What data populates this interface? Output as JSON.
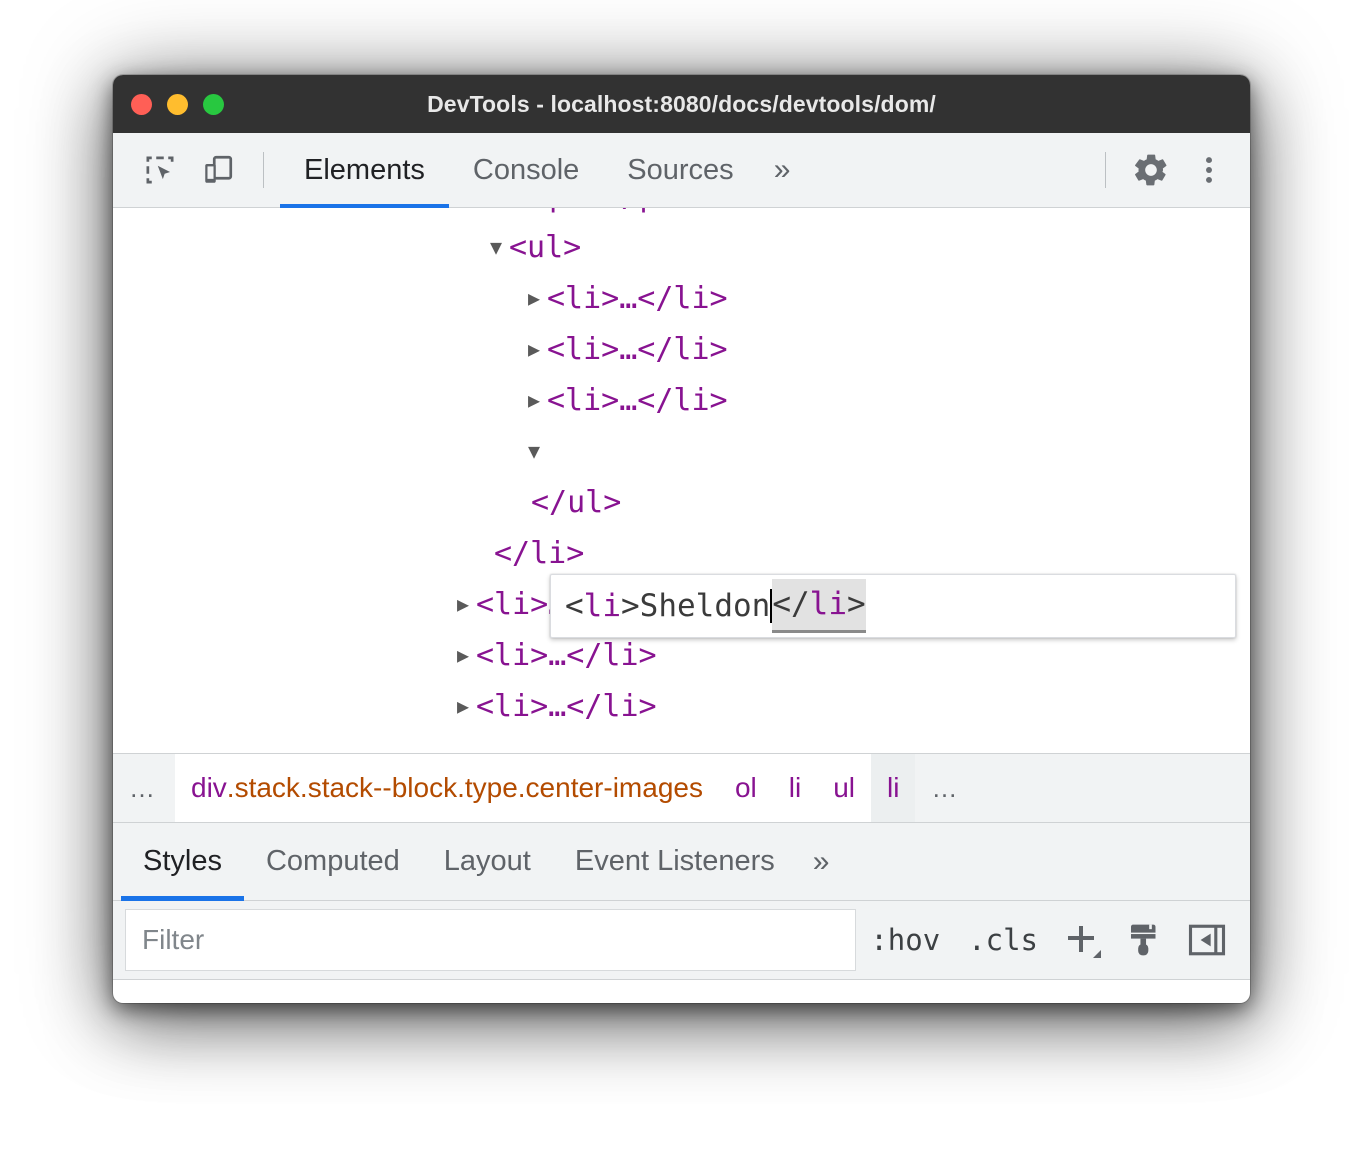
{
  "window": {
    "title": "DevTools - localhost:8080/docs/devtools/dom/",
    "traffic": {
      "close": "close-button",
      "minimize": "minimize-button",
      "zoom": "zoom-button"
    }
  },
  "toolbar": {
    "inspect_icon": "inspect-element-icon",
    "device_icon": "device-toolbar-icon",
    "tabs": [
      {
        "label": "Elements",
        "active": true
      },
      {
        "label": "Console",
        "active": false
      },
      {
        "label": "Sources",
        "active": false
      }
    ],
    "more_tabs": "»",
    "settings_icon": "gear-icon",
    "menu_icon": "more-vertical-icon"
  },
  "dom_tree": {
    "rows": [
      {
        "twisty": "",
        "text": "<p>…</p>",
        "indent": 1,
        "clipped": true
      },
      {
        "twisty": "▼",
        "text": "<ul>",
        "indent": 1
      },
      {
        "twisty": "▶",
        "text": "<li>…</li>",
        "indent": 2
      },
      {
        "twisty": "▶",
        "text": "<li>…</li>",
        "indent": 2
      },
      {
        "twisty": "▶",
        "text": "<li>…</li>",
        "indent": 2
      },
      {
        "twisty": "▼",
        "text": "",
        "indent": 2,
        "editing": true
      },
      {
        "twisty": "",
        "text": "</ul>",
        "indent": 1
      },
      {
        "twisty": "",
        "text": "</li>",
        "indent": 0
      },
      {
        "twisty": "▶",
        "text": "<li>…</li>",
        "indent": 0
      },
      {
        "twisty": "▶",
        "text": "<li>…</li>",
        "indent": 0
      },
      {
        "twisty": "▶",
        "text": "<li>…</li>",
        "indent": 0
      }
    ]
  },
  "edit_box": {
    "open_angle": "<",
    "open_tag": "li",
    "open_angle_close": ">",
    "value": "Sheldon",
    "close_tag_text": "</li>",
    "selected": true
  },
  "breadcrumb": {
    "left_ellipsis": "…",
    "items": [
      {
        "tag": "div",
        "classes": ".stack.stack--block.type.center-images",
        "state": "white"
      },
      {
        "tag": "ol",
        "classes": "",
        "state": "white"
      },
      {
        "tag": "li",
        "classes": "",
        "state": "white"
      },
      {
        "tag": "ul",
        "classes": "",
        "state": "white"
      },
      {
        "tag": "li",
        "classes": "",
        "state": "selected"
      }
    ],
    "right_ellipsis": "…"
  },
  "styles_pane": {
    "tabs": [
      {
        "label": "Styles",
        "active": true
      },
      {
        "label": "Computed",
        "active": false
      },
      {
        "label": "Layout",
        "active": false
      },
      {
        "label": "Event Listeners",
        "active": false
      }
    ],
    "more_tabs": "»",
    "filter": {
      "placeholder": "Filter",
      "value": ""
    },
    "hov_label": ":hov",
    "cls_label": ".cls",
    "new_rule_icon": "plus-icon",
    "computed_icon": "paintbrush-icon",
    "sidebar_toggle_icon": "sidebar-toggle-icon"
  },
  "colors": {
    "tag_purple": "#881391",
    "class_orange": "#b34b00",
    "accent_blue": "#1a73e8",
    "titlebar_bg": "#323232",
    "toolbar_bg": "#f1f3f4"
  }
}
